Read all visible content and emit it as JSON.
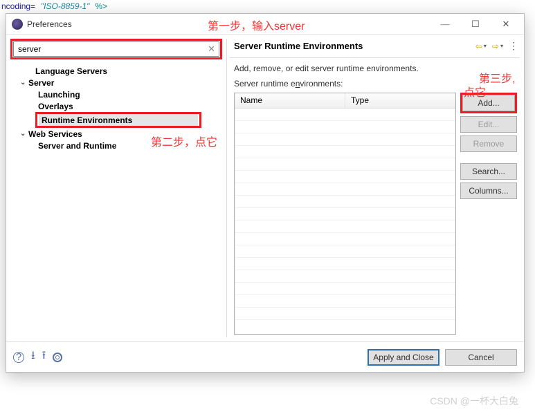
{
  "code_fragment_html": "ncoding= ISO-8859-1 %>",
  "window": {
    "title": "Preferences",
    "minimize": "—",
    "maximize": "☐",
    "close": "✕"
  },
  "search": {
    "value": "server",
    "clear": "✕"
  },
  "tree": {
    "language_servers": "Language Servers",
    "server": "Server",
    "launching": "Launching",
    "overlays": "Overlays",
    "runtime_env": "Runtime Environments",
    "web_services": "Web Services",
    "server_and_runtime": "Server and Runtime"
  },
  "right": {
    "title": "Server Runtime Environments",
    "desc": "Add, remove, or edit server runtime environments.",
    "sub": "Server runtime e_nvironments:",
    "cols": {
      "name": "Name",
      "type": "Type"
    },
    "buttons": {
      "add": "Add...",
      "edit": "Edit...",
      "remove": "Remove",
      "search": "Search...",
      "columns": "Columns..."
    }
  },
  "footer": {
    "apply": "Apply and Close",
    "cancel": "Cancel"
  },
  "annotations": {
    "step1": "第一步，输入server",
    "step2": "第二步，点它",
    "step3a": "第三步,",
    "step3b": "点它"
  },
  "watermark": "CSDN @一杯大白兔"
}
